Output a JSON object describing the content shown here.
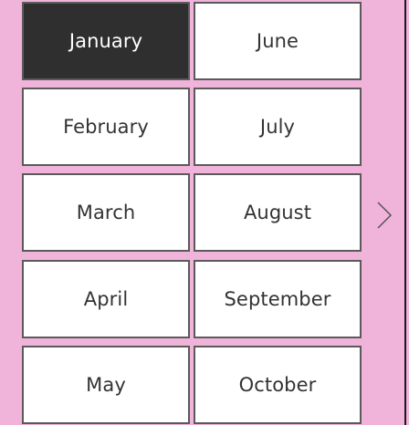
{
  "month_picker": {
    "selected_month": "January",
    "columns": [
      [
        "January",
        "February",
        "March",
        "April",
        "May"
      ],
      [
        "June",
        "July",
        "August",
        "September",
        "October"
      ]
    ],
    "next_icon": "chevron-right-icon",
    "colors": {
      "background": "#f0b4da",
      "tile_background": "#ffffff",
      "tile_border": "#5a5a5a",
      "selected_background": "#2f2f2f",
      "selected_text": "#ffffff",
      "text": "#333333"
    }
  }
}
